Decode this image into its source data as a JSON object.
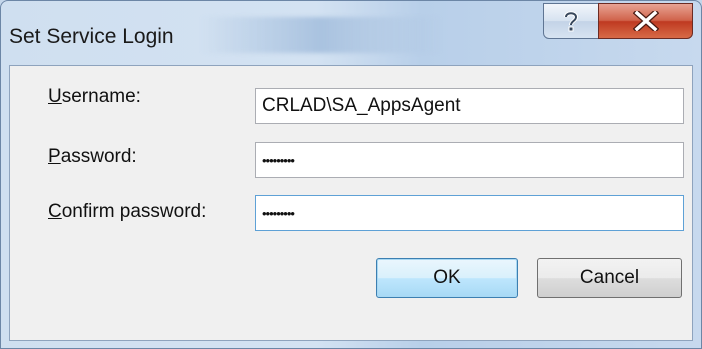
{
  "window": {
    "title": "Set Service Login",
    "help_icon": "question-mark-icon",
    "close_icon": "close-x-icon"
  },
  "form": {
    "username": {
      "label_accel": "U",
      "label_rest": "sername:",
      "value": "CRLAD\\SA_AppsAgent"
    },
    "password": {
      "label_accel": "P",
      "label_rest": "assword:",
      "value": "•••••••••"
    },
    "confirm": {
      "label_accel": "C",
      "label_rest": "onfirm password:",
      "value": "•••••••••"
    }
  },
  "buttons": {
    "ok": "OK",
    "cancel": "Cancel"
  },
  "colors": {
    "close_button": "#c8442a",
    "focus_border": "#5ea1d6",
    "default_button": "#3c7fb1"
  }
}
